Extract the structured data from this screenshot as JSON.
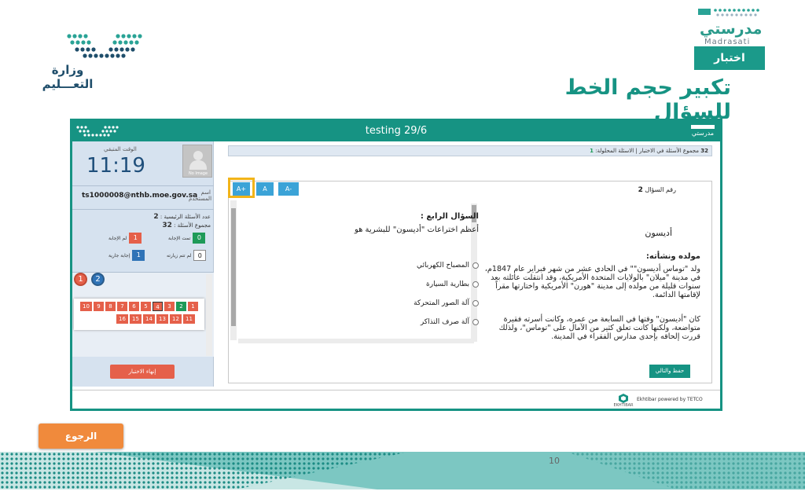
{
  "header": {
    "ministry_name": "وزارة التعـــليم",
    "platform_ar": "مدرستي",
    "platform_en": "Madrasati",
    "section_label": "اختبار",
    "slide_title": "تكبير حجم الخط للسؤال"
  },
  "app": {
    "window_title": "testing 29/6",
    "bar_logo_text": "مدرستي",
    "timer": {
      "label": "الوقت المتبقي",
      "value": "11:19",
      "avatar_caption": "No Image"
    },
    "user": {
      "label": "اسم المستخدم",
      "value": "ts1000008@nthb.moe.gov.sa"
    },
    "counts": {
      "main_questions_label": "عدد الأسئلة الرئيسية :",
      "main_questions_value": "2",
      "total_questions_label": "مجموع الأسئلة :",
      "total_questions_value": "32"
    },
    "legend": [
      {
        "count": "0",
        "label": "تمت الإجابة",
        "color": "#1e9a58"
      },
      {
        "count": "1",
        "label": "لم الإجابة",
        "color": "#e5604a"
      },
      {
        "count": "0",
        "label": "لم تتم زيارته",
        "color": "#ffffff"
      },
      {
        "count": "1",
        "label": "إجابة جارية",
        "color": "#2f73b7"
      }
    ],
    "group_circles": [
      "1",
      "2"
    ],
    "question_numbers_row1": [
      "1",
      "2",
      "3",
      "4",
      "5",
      "6",
      "7",
      "8",
      "9",
      "10"
    ],
    "question_numbers_row2": [
      "11",
      "12",
      "13",
      "14",
      "15",
      "16"
    ],
    "end_button": "إنهاء الاختبار",
    "summary_bar": {
      "total_label": "مجموع الأسئلة في الاختبار",
      "total_value": "32",
      "solved_label": "الاسئلة المحلولة",
      "solved_value": "1"
    },
    "font_buttons": [
      "A+",
      "A",
      "A-"
    ],
    "question_number_label": "رقم السؤال",
    "question_number_value": "2",
    "passage": {
      "title": "أديسون",
      "subtitle": "مولده ونشأته:",
      "para1": "ولد \"توماس أديسون\"\" في الحادي عشر من شهر فبراير عام 1847م، في مدينة \"ميلان\" بالولايات المتحدة الأمريكية، وقد انتقلت عائلته بعد سنوات قليلة من مولده إلى مدينة \"هورن\" الأمريكية واختارتها مقراً لإقامتها الدائمة.",
      "para2": "كان \"أديسون\" وقتها في السابعة من عمره، وكانت أسرته فقيرة متواضعة، ولكنها كانت تعلق كثير من الآمال على \"توماس\"، ولذلك قررت إلحاقه بإحدى مدارس الفقراء في المدينة.",
      "para3": "..."
    },
    "question": {
      "heading": "السؤال الرابع :",
      "text": "أعظم اختراعات \"أديسون\" للبشرية هو",
      "options": [
        "المصباح الكهربائي",
        "بطارية السيارة",
        "آلة الصور المتحركة",
        "آلة صرف التذاكر"
      ]
    },
    "save_button": "حفظ والتالي",
    "footer": "Ekhtibar powered by TETCO",
    "footer_logo": "EKHTIBAR"
  },
  "back_button": "الرجوع",
  "page_number": "10",
  "colors": {
    "teal": "#169383",
    "orange": "#f08a3c",
    "highlight": "#f2b419",
    "blue": "#3ba3d7"
  }
}
